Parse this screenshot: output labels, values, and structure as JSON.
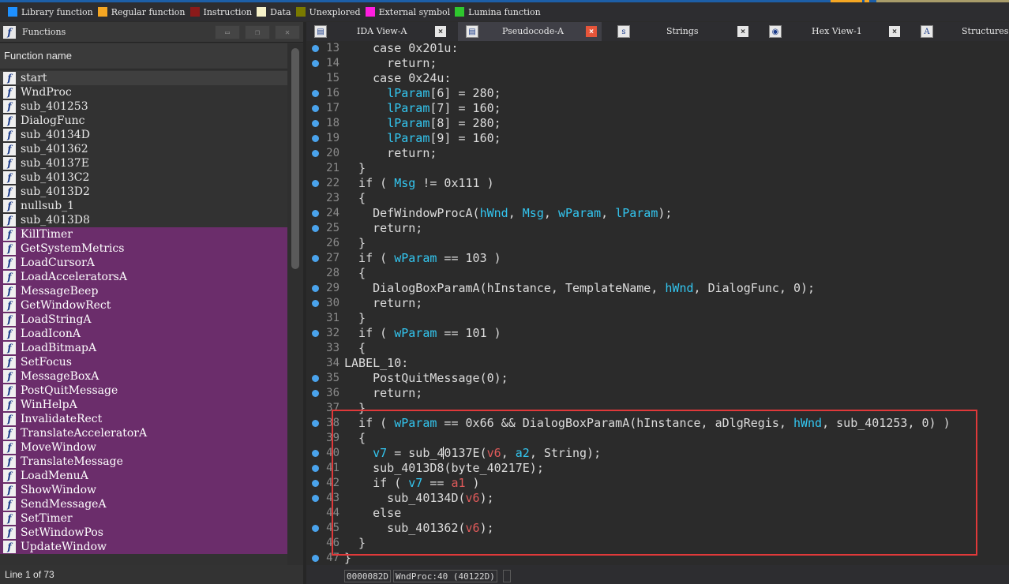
{
  "legend": [
    {
      "label": "Library function",
      "color": "#1e90ff"
    },
    {
      "label": "Regular function",
      "color": "#f5a623"
    },
    {
      "label": "Instruction",
      "color": "#8b1a1a"
    },
    {
      "label": "Data",
      "color": "#f5f0c8"
    },
    {
      "label": "Unexplored",
      "color": "#7a7a00"
    },
    {
      "label": "External symbol",
      "color": "#ff1ee0"
    },
    {
      "label": "Lumina function",
      "color": "#2ec72e"
    }
  ],
  "functions_panel": {
    "title": "Functions",
    "column_header": "Function name",
    "status": "Line 1 of 73",
    "icon_glyph": "f",
    "items": [
      {
        "name": "start",
        "kind": "regular",
        "selected": true
      },
      {
        "name": "WndProc",
        "kind": "regular"
      },
      {
        "name": "sub_401253",
        "kind": "regular"
      },
      {
        "name": "DialogFunc",
        "kind": "regular"
      },
      {
        "name": "sub_40134D",
        "kind": "regular"
      },
      {
        "name": "sub_401362",
        "kind": "regular"
      },
      {
        "name": "sub_40137E",
        "kind": "regular"
      },
      {
        "name": "sub_4013C2",
        "kind": "regular"
      },
      {
        "name": "sub_4013D2",
        "kind": "regular"
      },
      {
        "name": "nullsub_1",
        "kind": "regular"
      },
      {
        "name": "sub_4013D8",
        "kind": "regular"
      },
      {
        "name": "KillTimer",
        "kind": "import"
      },
      {
        "name": "GetSystemMetrics",
        "kind": "import"
      },
      {
        "name": "LoadCursorA",
        "kind": "import"
      },
      {
        "name": "LoadAcceleratorsA",
        "kind": "import"
      },
      {
        "name": "MessageBeep",
        "kind": "import"
      },
      {
        "name": "GetWindowRect",
        "kind": "import"
      },
      {
        "name": "LoadStringA",
        "kind": "import"
      },
      {
        "name": "LoadIconA",
        "kind": "import"
      },
      {
        "name": "LoadBitmapA",
        "kind": "import"
      },
      {
        "name": "SetFocus",
        "kind": "import"
      },
      {
        "name": "MessageBoxA",
        "kind": "import"
      },
      {
        "name": "PostQuitMessage",
        "kind": "import"
      },
      {
        "name": "WinHelpA",
        "kind": "import"
      },
      {
        "name": "InvalidateRect",
        "kind": "import"
      },
      {
        "name": "TranslateAcceleratorA",
        "kind": "import"
      },
      {
        "name": "MoveWindow",
        "kind": "import"
      },
      {
        "name": "TranslateMessage",
        "kind": "import"
      },
      {
        "name": "LoadMenuA",
        "kind": "import"
      },
      {
        "name": "ShowWindow",
        "kind": "import"
      },
      {
        "name": "SendMessageA",
        "kind": "import"
      },
      {
        "name": "SetTimer",
        "kind": "import"
      },
      {
        "name": "SetWindowPos",
        "kind": "import"
      },
      {
        "name": "UpdateWindow",
        "kind": "import"
      }
    ]
  },
  "tabs": [
    {
      "label": "IDA View-A",
      "icon": "ida-view-icon",
      "glyph": "▤",
      "active": false,
      "closable": true
    },
    {
      "label": "Pseudocode-A",
      "icon": "pseudocode-icon",
      "glyph": "▤",
      "active": true,
      "closable": true
    },
    {
      "label": "Strings",
      "icon": "strings-icon",
      "glyph": "s",
      "active": false,
      "closable": true
    },
    {
      "label": "Hex View-1",
      "icon": "hex-view-icon",
      "glyph": "◉",
      "active": false,
      "closable": true
    },
    {
      "label": "Structures",
      "icon": "structures-icon",
      "glyph": "A",
      "active": false,
      "closable": false
    }
  ],
  "close_glyph": "×",
  "code_lines": [
    {
      "num": "13",
      "bp": true,
      "tokens": [
        [
          "    case 0x201u:",
          "pl"
        ]
      ]
    },
    {
      "num": "14",
      "bp": true,
      "tokens": [
        [
          "      return;",
          "pl"
        ]
      ]
    },
    {
      "num": "15",
      "bp": false,
      "tokens": [
        [
          "    case 0x24u:",
          "pl"
        ]
      ]
    },
    {
      "num": "16",
      "bp": true,
      "tokens": [
        [
          "      ",
          "pl"
        ],
        [
          "lParam",
          "var"
        ],
        [
          "[6] = 280;",
          "pl"
        ]
      ]
    },
    {
      "num": "17",
      "bp": true,
      "tokens": [
        [
          "      ",
          "pl"
        ],
        [
          "lParam",
          "var"
        ],
        [
          "[7] = 160;",
          "pl"
        ]
      ]
    },
    {
      "num": "18",
      "bp": true,
      "tokens": [
        [
          "      ",
          "pl"
        ],
        [
          "lParam",
          "var"
        ],
        [
          "[8] = 280;",
          "pl"
        ]
      ]
    },
    {
      "num": "19",
      "bp": true,
      "tokens": [
        [
          "      ",
          "pl"
        ],
        [
          "lParam",
          "var"
        ],
        [
          "[9] = 160;",
          "pl"
        ]
      ]
    },
    {
      "num": "20",
      "bp": true,
      "tokens": [
        [
          "      return;",
          "pl"
        ]
      ]
    },
    {
      "num": "21",
      "bp": false,
      "tokens": [
        [
          "  }",
          "pl"
        ]
      ]
    },
    {
      "num": "22",
      "bp": true,
      "tokens": [
        [
          "  if ( ",
          "pl"
        ],
        [
          "Msg",
          "var"
        ],
        [
          " != 0x111 )",
          "pl"
        ]
      ]
    },
    {
      "num": "23",
      "bp": false,
      "tokens": [
        [
          "  {",
          "pl"
        ]
      ]
    },
    {
      "num": "24",
      "bp": true,
      "tokens": [
        [
          "    DefWindowProcA(",
          "pl"
        ],
        [
          "hWnd",
          "var"
        ],
        [
          ", ",
          "pl"
        ],
        [
          "Msg",
          "var"
        ],
        [
          ", ",
          "pl"
        ],
        [
          "wParam",
          "var"
        ],
        [
          ", ",
          "pl"
        ],
        [
          "lParam",
          "var"
        ],
        [
          ");",
          "pl"
        ]
      ]
    },
    {
      "num": "25",
      "bp": true,
      "tokens": [
        [
          "    return;",
          "pl"
        ]
      ]
    },
    {
      "num": "26",
      "bp": false,
      "tokens": [
        [
          "  }",
          "pl"
        ]
      ]
    },
    {
      "num": "27",
      "bp": true,
      "tokens": [
        [
          "  if ( ",
          "pl"
        ],
        [
          "wParam",
          "var"
        ],
        [
          " == 103 )",
          "pl"
        ]
      ]
    },
    {
      "num": "28",
      "bp": false,
      "tokens": [
        [
          "  {",
          "pl"
        ]
      ]
    },
    {
      "num": "29",
      "bp": true,
      "tokens": [
        [
          "    DialogBoxParamA(hInstance, TemplateName, ",
          "pl"
        ],
        [
          "hWnd",
          "var"
        ],
        [
          ", DialogFunc, 0);",
          "pl"
        ]
      ]
    },
    {
      "num": "30",
      "bp": true,
      "tokens": [
        [
          "    return;",
          "pl"
        ]
      ]
    },
    {
      "num": "31",
      "bp": false,
      "tokens": [
        [
          "  }",
          "pl"
        ]
      ]
    },
    {
      "num": "32",
      "bp": true,
      "tokens": [
        [
          "  if ( ",
          "pl"
        ],
        [
          "wParam",
          "var"
        ],
        [
          " == 101 )",
          "pl"
        ]
      ]
    },
    {
      "num": "33",
      "bp": false,
      "tokens": [
        [
          "  {",
          "pl"
        ]
      ]
    },
    {
      "num": "34",
      "bp": false,
      "label": true,
      "tokens": [
        [
          "LABEL_10:",
          "pl"
        ]
      ]
    },
    {
      "num": "35",
      "bp": true,
      "tokens": [
        [
          "    PostQuitMessage(0);",
          "pl"
        ]
      ]
    },
    {
      "num": "36",
      "bp": true,
      "tokens": [
        [
          "    return;",
          "pl"
        ]
      ]
    },
    {
      "num": "37",
      "bp": false,
      "tokens": [
        [
          "  }",
          "pl"
        ]
      ]
    },
    {
      "num": "38",
      "bp": true,
      "tokens": [
        [
          "  if ( ",
          "pl"
        ],
        [
          "wParam",
          "var"
        ],
        [
          " == 0x66 && DialogBoxParamA(hInstance, aDlgRegis, ",
          "pl"
        ],
        [
          "hWnd",
          "var"
        ],
        [
          ", sub_401253, 0) )",
          "pl"
        ]
      ]
    },
    {
      "num": "39",
      "bp": false,
      "tokens": [
        [
          "  {",
          "pl"
        ]
      ]
    },
    {
      "num": "40",
      "bp": true,
      "tokens": [
        [
          "    ",
          "pl"
        ],
        [
          "v7",
          "var"
        ],
        [
          " = sub_40137E(",
          "pl"
        ],
        [
          "v6",
          "lv"
        ],
        [
          ", ",
          "pl"
        ],
        [
          "a2",
          "var"
        ],
        [
          ", String);",
          "pl"
        ]
      ]
    },
    {
      "num": "41",
      "bp": true,
      "tokens": [
        [
          "    sub_4013D8(byte_40217E);",
          "pl"
        ]
      ]
    },
    {
      "num": "42",
      "bp": true,
      "tokens": [
        [
          "    if ( ",
          "pl"
        ],
        [
          "v7",
          "var"
        ],
        [
          " == ",
          "pl"
        ],
        [
          "a1",
          "lv"
        ],
        [
          " )",
          "pl"
        ]
      ]
    },
    {
      "num": "43",
      "bp": true,
      "tokens": [
        [
          "      sub_40134D(",
          "pl"
        ],
        [
          "v6",
          "lv"
        ],
        [
          ");",
          "pl"
        ]
      ]
    },
    {
      "num": "44",
      "bp": false,
      "tokens": [
        [
          "    else",
          "pl"
        ]
      ]
    },
    {
      "num": "45",
      "bp": true,
      "tokens": [
        [
          "      sub_401362(",
          "pl"
        ],
        [
          "v6",
          "lv"
        ],
        [
          ");",
          "pl"
        ]
      ]
    },
    {
      "num": "46",
      "bp": false,
      "tokens": [
        [
          "  }",
          "pl"
        ]
      ]
    },
    {
      "num": "47",
      "bp": true,
      "tokens": [
        [
          "}",
          "pl"
        ]
      ]
    }
  ],
  "status_bar": {
    "address": "0000082D",
    "location": "WndProc:40 (40122D)"
  }
}
